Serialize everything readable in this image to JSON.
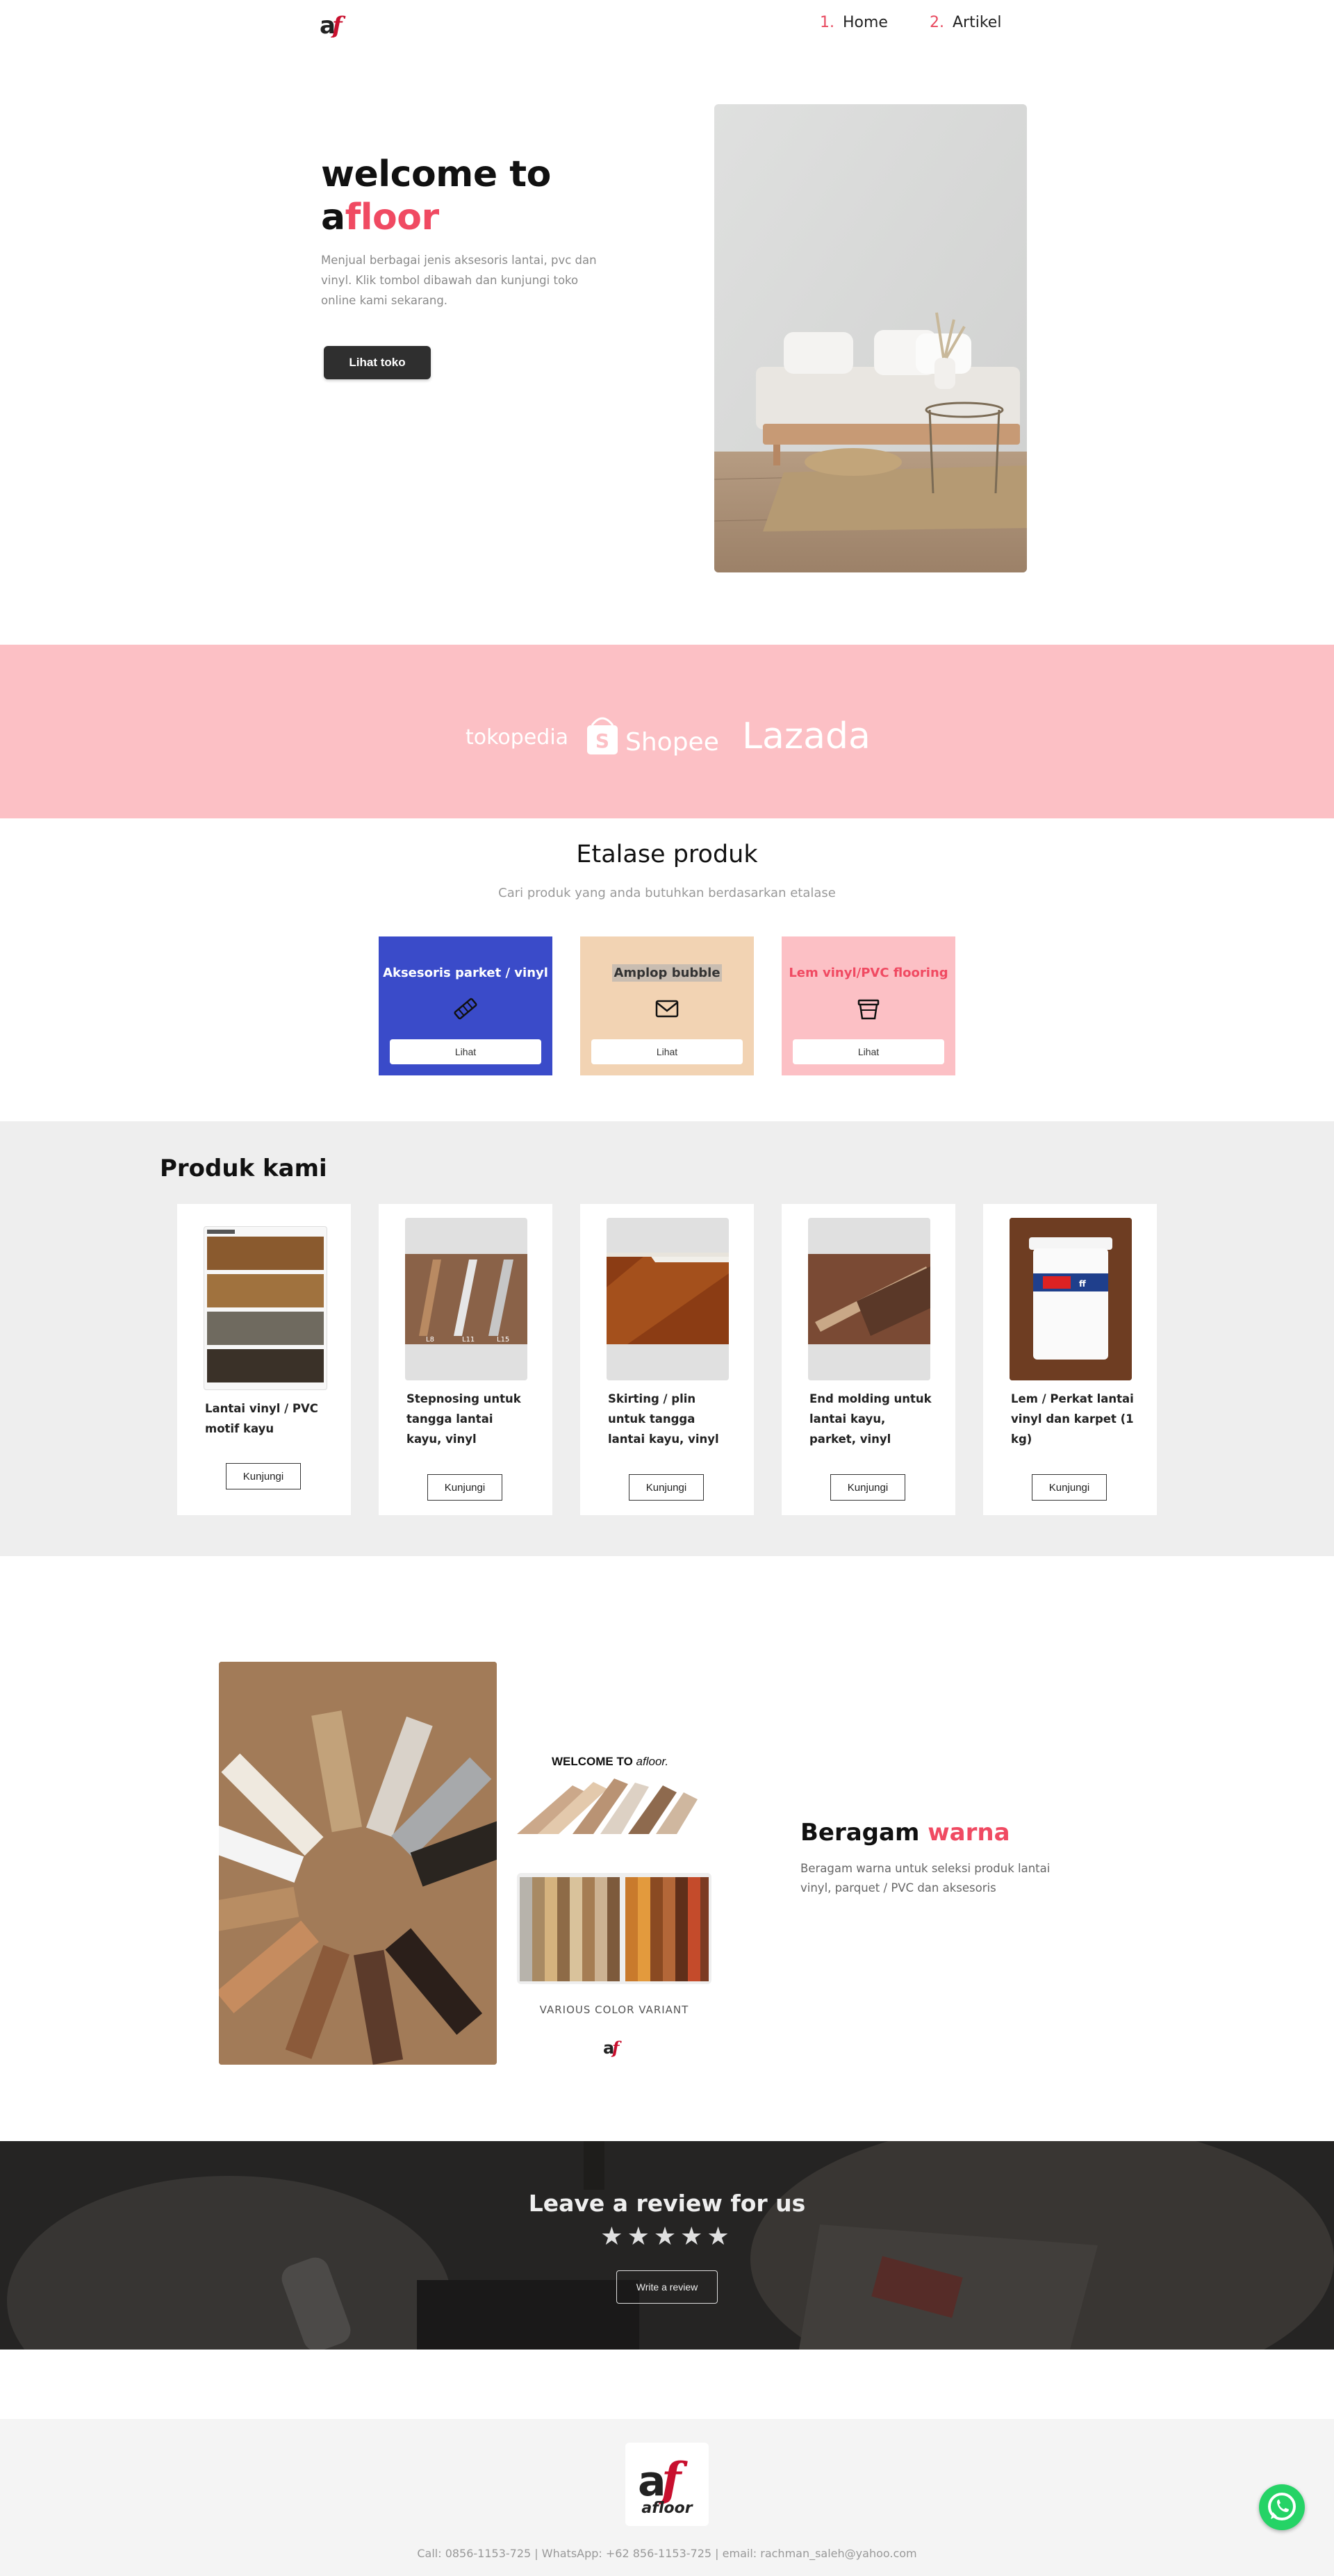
{
  "brand": {
    "name": "afloor"
  },
  "nav": {
    "items": [
      {
        "num": "1.",
        "label": "Home"
      },
      {
        "num": "2.",
        "label": "Artikel"
      }
    ]
  },
  "hero": {
    "title_line1": "welcome to",
    "title_prefix": "a",
    "title_accent": "floor",
    "subtitle": "Menjual berbagai jenis aksesoris lantai, pvc dan vinyl. Klik tombol dibawah dan kunjungi toko online kami sekarang.",
    "button": "Lihat toko"
  },
  "marketplaces": [
    "tokopedia",
    "Shopee",
    "Lazada"
  ],
  "etalase": {
    "title": "Etalase produk",
    "subtitle": "Cari produk yang anda butuhkan berdasarkan etalase",
    "categories": [
      {
        "title": "Aksesoris parket / vinyl",
        "button": "Lihat",
        "bg": "#3a4bc9",
        "fg": "#ffffff",
        "icon": "wood-plank-icon"
      },
      {
        "title": "Amplop bubble",
        "button": "Lihat",
        "bg": "#f2d3b3",
        "fg": "#333333",
        "icon": "envelope-icon"
      },
      {
        "title": "Lem vinyl/PVC flooring",
        "button": "Lihat",
        "bg": "#fcc0c5",
        "fg": "#f04a62",
        "icon": "bucket-icon"
      }
    ]
  },
  "produk": {
    "title": "Produk kami",
    "items": [
      {
        "name": "Lantai vinyl / PVC motif kayu",
        "button": "Kunjungi"
      },
      {
        "name": "Stepnosing untuk tangga lantai kayu, vinyl",
        "button": "Kunjungi"
      },
      {
        "name": "Skirting / plin untuk tangga lantai kayu, vinyl",
        "button": "Kunjungi"
      },
      {
        "name": "End molding untuk lantai kayu, parket, vinyl",
        "button": "Kunjungi"
      },
      {
        "name": "Lem / Perkat lantai vinyl dan karpet (1 kg)",
        "button": "Kunjungi"
      }
    ]
  },
  "warna": {
    "title_prefix": "Beragam",
    "title_accent": "warna",
    "text": "Beragam warna untuk seleksi produk lantai vinyl, parquet / PVC dan aksesoris",
    "poster_heading": "WELCOME TO",
    "poster_brand": "afloor.",
    "poster_caption": "VARIOUS COLOR VARIANT"
  },
  "review": {
    "title": "Leave a review for us",
    "stars": 5,
    "button": "Write a review"
  },
  "footer": {
    "brand": "afloor",
    "contact": "Call: 0856-1153-725 | WhatsApp: +62 856-1153-725 | email: rachman_saleh@yahoo.com"
  },
  "colors": {
    "accent": "#f04a62",
    "band": "#fcc0c5",
    "whatsapp": "#25d366"
  }
}
